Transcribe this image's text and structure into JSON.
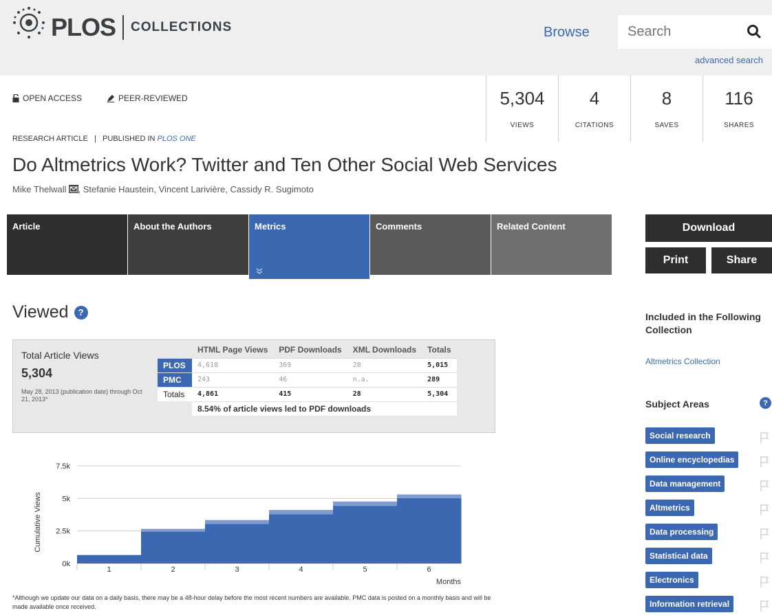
{
  "header": {
    "logo_text": "PLOS",
    "logo_sub": "COLLECTIONS",
    "browse_label": "Browse",
    "search_placeholder": "Search",
    "advanced_search": "advanced search"
  },
  "badges": {
    "open_access": "OPEN ACCESS",
    "peer_reviewed": "PEER-REVIEWED"
  },
  "metrics": [
    {
      "value": "5,304",
      "label": "VIEWS"
    },
    {
      "value": "4",
      "label": "CITATIONS"
    },
    {
      "value": "8",
      "label": "SAVES"
    },
    {
      "value": "116",
      "label": "SHARES"
    }
  ],
  "article": {
    "type": "RESEARCH ARTICLE",
    "separator": "|",
    "published_in": "PUBLISHED IN",
    "journal": "PLOS ONE",
    "title": "Do Altmetrics Work? Twitter and Ten Other Social Web Services",
    "authors": [
      "Mike Thelwall",
      "Stefanie Haustein",
      "Vincent Larivière",
      "Cassidy R. Sugimoto"
    ]
  },
  "tabs": [
    "Article",
    "About the Authors",
    "Metrics",
    "Comments",
    "Related Content"
  ],
  "sidebar": {
    "download": "Download",
    "print": "Print",
    "share": "Share",
    "collection_title": "Included in the Following Collection",
    "collection_link": "Altmetrics Collection",
    "subject_title": "Subject Areas",
    "subjects": [
      "Social research",
      "Online encyclopedias",
      "Data management",
      "Altmetrics",
      "Data processing",
      "Statistical data",
      "Electronics",
      "Information retrieval"
    ]
  },
  "viewed": {
    "title": "Viewed",
    "total_label": "Total Article Views",
    "total_value": "5,304",
    "date_range": "May 28, 2013 (publication date) through Oct 21, 2013*",
    "columns": [
      "HTML Page Views",
      "PDF Downloads",
      "XML Downloads",
      "Totals"
    ],
    "rows": [
      {
        "source": "PLOS",
        "html": "4,618",
        "pdf": "369",
        "xml": "28",
        "total": "5,015"
      },
      {
        "source": "PMC",
        "html": "243",
        "pdf": "46",
        "xml": "n.a.",
        "total": "289"
      },
      {
        "source": "Totals",
        "html": "4,861",
        "pdf": "415",
        "xml": "28",
        "total": "5,304"
      }
    ],
    "summary": "8.54% of article views led to PDF downloads",
    "footnote": "*Although we update our data on a daily basis, there may be a 48-hour delay before the most recent numbers are available. PMC data is posted on a monthly basis and will be made available once received."
  },
  "chart_data": {
    "type": "area",
    "xlabel": "Months",
    "ylabel": "Cumulative Views",
    "categories": [
      "1",
      "2",
      "3",
      "4",
      "5",
      "6"
    ],
    "yticks": [
      "0k",
      "2.5k",
      "5k",
      "7.5k"
    ],
    "ylim": [
      0,
      7500
    ],
    "series": [
      {
        "name": "PLOS",
        "values": [
          650,
          2450,
          3050,
          3780,
          4430,
          5015
        ]
      },
      {
        "name": "PMC",
        "values": [
          0,
          210,
          290,
          330,
          330,
          289
        ]
      }
    ],
    "colors": {
      "plos": "#3c68b1",
      "pmc": "#7f9bd0"
    }
  }
}
